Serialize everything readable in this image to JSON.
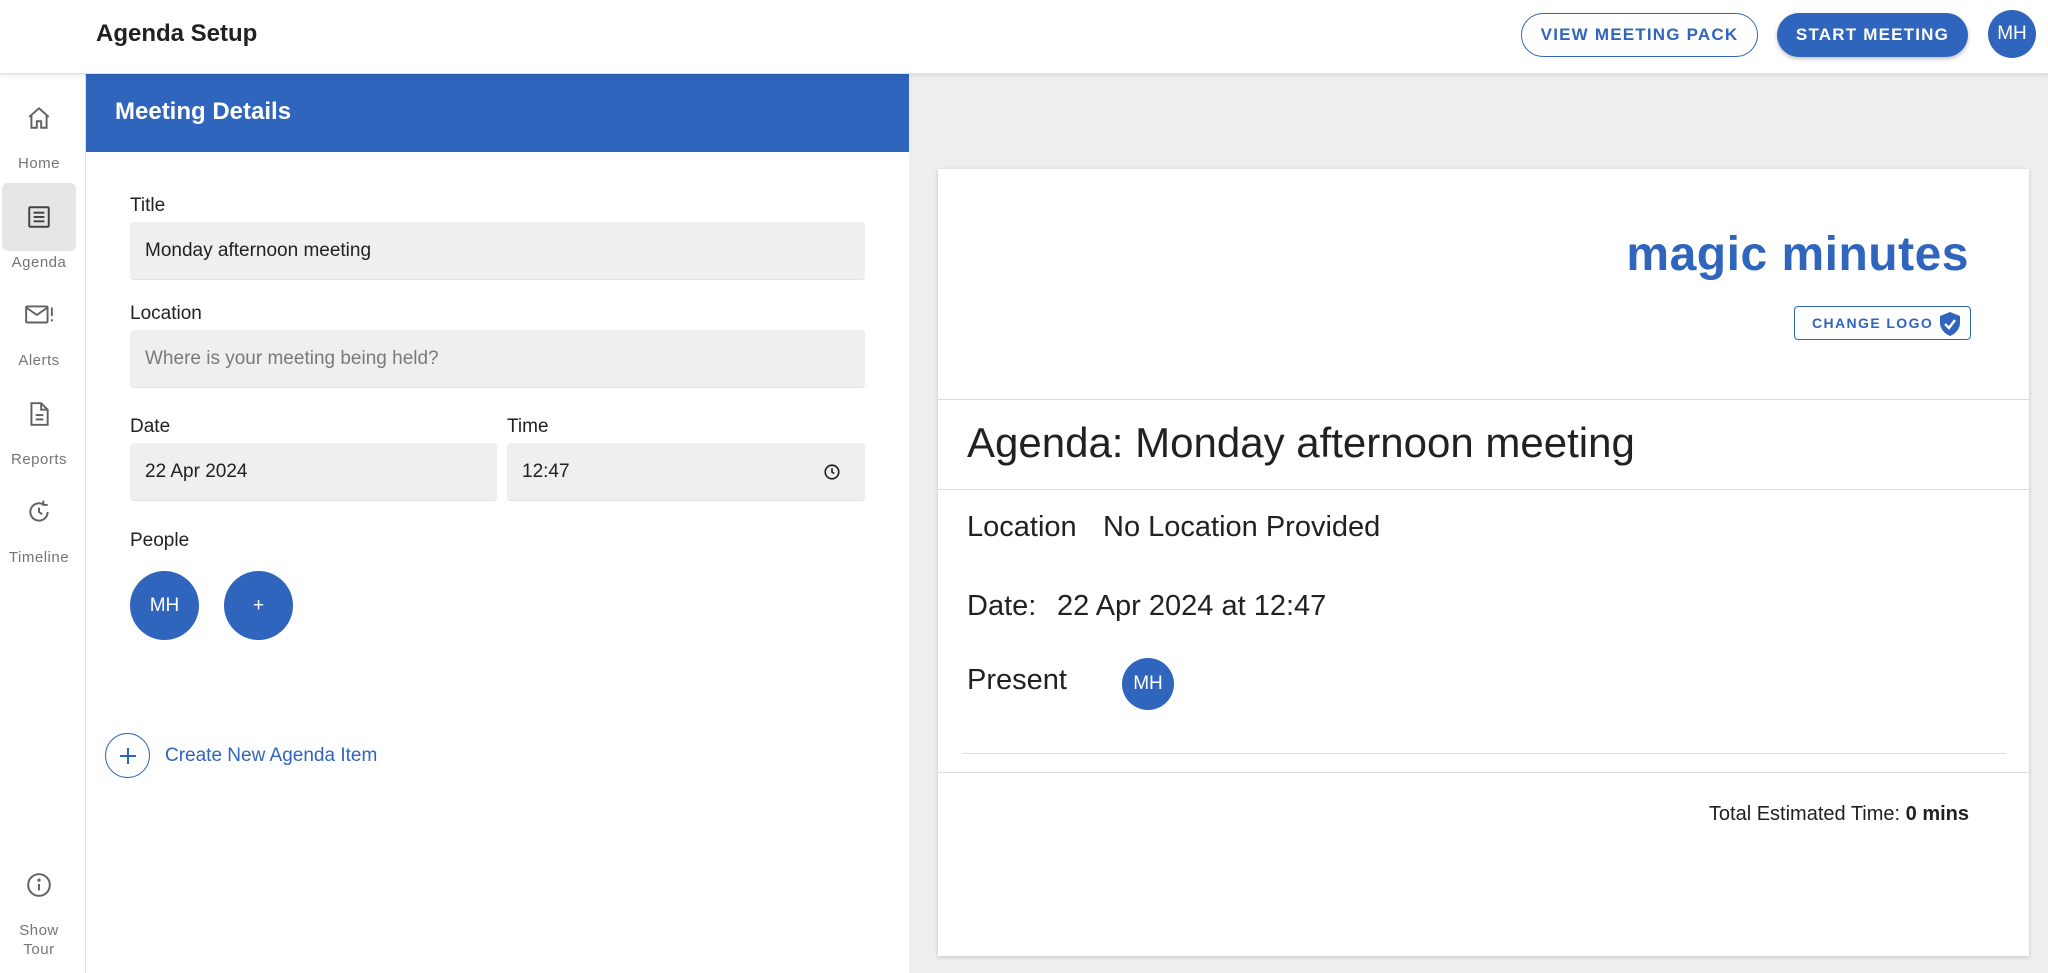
{
  "header": {
    "title": "Agenda Setup",
    "view_pack_label": "VIEW MEETING PACK",
    "start_label": "START MEETING",
    "user_initials": "MH"
  },
  "sidebar": {
    "items": [
      {
        "label": "Home",
        "icon": "home-icon"
      },
      {
        "label": "Agenda",
        "icon": "list-icon"
      },
      {
        "label": "Alerts",
        "icon": "mail-alert-icon"
      },
      {
        "label": "Reports",
        "icon": "document-icon"
      },
      {
        "label": "Timeline",
        "icon": "history-icon"
      }
    ],
    "show_tour_line1": "Show",
    "show_tour_line2": "Tour"
  },
  "details": {
    "header": "Meeting Details",
    "title_label": "Title",
    "title_value": "Monday afternoon meeting",
    "location_label": "Location",
    "location_placeholder": "Where is your meeting being held?",
    "date_label": "Date",
    "date_value": "22 Apr 2024",
    "time_label": "Time",
    "time_value": "12:47",
    "people_label": "People",
    "people": [
      "MH"
    ],
    "add_person": "+",
    "create_item_label": "Create New Agenda Item"
  },
  "preview": {
    "logo_text": "magic minutes",
    "change_logo_label": "CHANGE LOGO",
    "agenda_title": "Agenda: Monday afternoon meeting",
    "location_label": "Location",
    "location_value": "No Location Provided",
    "date_label": "Date:",
    "date_value": "22 Apr 2024 at 12:47",
    "present_label": "Present",
    "present_initials": "MH",
    "total_label": "Total Estimated Time:",
    "total_value": "0 mins"
  },
  "colors": {
    "primary": "#2f65bd",
    "preview_bg": "#eeeeee",
    "field_bg": "#efefef"
  }
}
